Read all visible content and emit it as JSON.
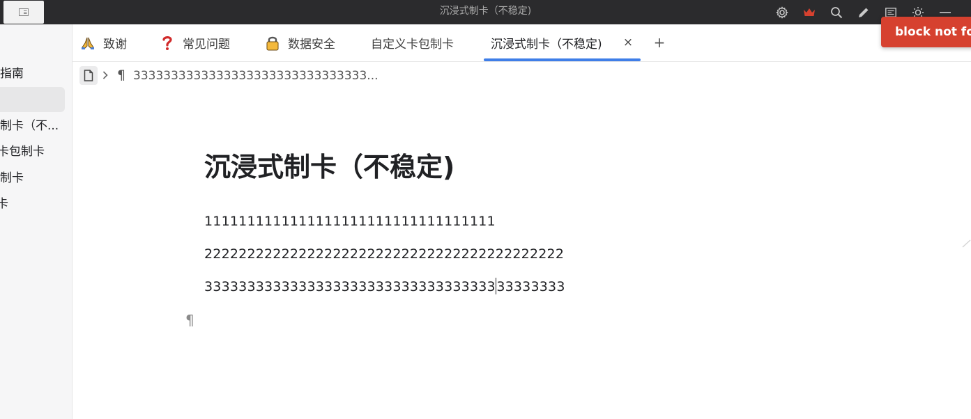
{
  "window": {
    "title": "沉浸式制卡（不稳定)"
  },
  "titlebar": {
    "icons": [
      "settings-icon",
      "crown-icon",
      "search-icon",
      "pencil-icon",
      "reader-icon",
      "theme-icon",
      "minimize-icon"
    ],
    "crown_color": "#d6412f"
  },
  "sidebar": {
    "items": [
      {
        "label": "指南"
      },
      {
        "label": ""
      },
      {
        "label": "制卡（不..."
      },
      {
        "label": "卡包制卡"
      },
      {
        "label": "制卡"
      },
      {
        "label": "卡"
      }
    ]
  },
  "tabs": {
    "items": [
      {
        "label": "致谢",
        "icon": "praying-hands-icon"
      },
      {
        "label": "常见问题",
        "icon": "question-mark-icon"
      },
      {
        "label": "数据安全",
        "icon": "lock-icon"
      },
      {
        "label": "自定义卡包制卡",
        "icon": ""
      },
      {
        "label": "沉浸式制卡（不稳定)",
        "icon": ""
      }
    ],
    "active_index": 4,
    "close_symbol": "×",
    "add_symbol": "+",
    "accent": "#3f7ee8"
  },
  "toast": {
    "message": "block not fou",
    "color": "#d6412f"
  },
  "breadcrumb": {
    "pilcrow": "¶",
    "text": "3333333333333333333333333333333..."
  },
  "editor": {
    "title": "沉浸式制卡（不稳定)",
    "paragraphs": [
      {
        "before": "1111111111111111111111111111111111",
        "after": ""
      },
      {
        "before": "222222222222222222222222222222222222222222",
        "after": ""
      },
      {
        "before": "3333333333333333333333333333333333",
        "after": "33333333"
      }
    ],
    "empty_block_marker": "¶"
  }
}
